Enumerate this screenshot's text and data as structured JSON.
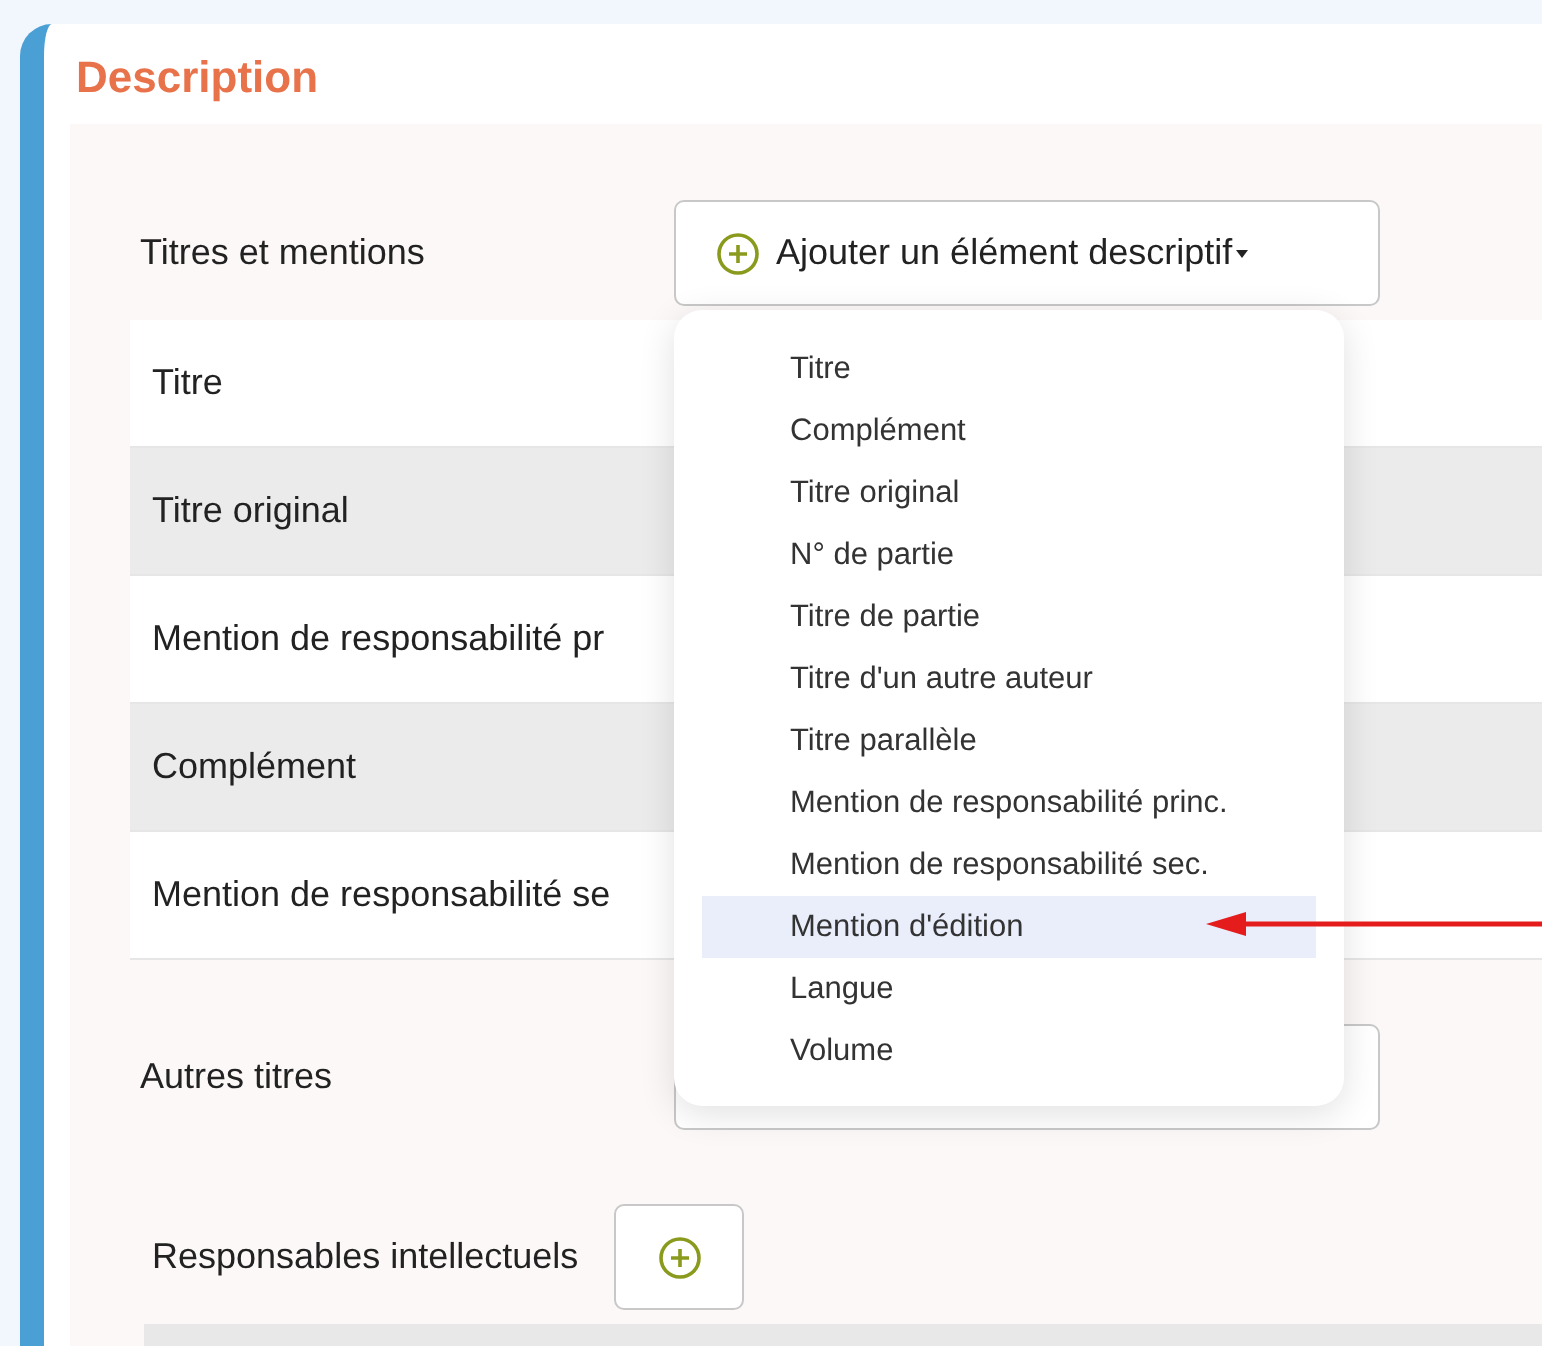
{
  "section": {
    "title": "Description"
  },
  "titles_field": {
    "label": "Titres et mentions",
    "button": {
      "label": "Ajouter un élément descriptif"
    }
  },
  "title_rows": [
    {
      "label": "Titre"
    },
    {
      "label": "Titre original"
    },
    {
      "label": "Mention de responsabilité pr"
    },
    {
      "label": "Complément"
    },
    {
      "label": "Mention de responsabilité se"
    }
  ],
  "dropdown": {
    "items": [
      {
        "label": "Titre",
        "selected": false
      },
      {
        "label": "Complément",
        "selected": false
      },
      {
        "label": "Titre original",
        "selected": false
      },
      {
        "label": "N° de partie",
        "selected": false
      },
      {
        "label": "Titre de partie",
        "selected": false
      },
      {
        "label": "Titre d'un autre auteur",
        "selected": false
      },
      {
        "label": "Titre parallèle",
        "selected": false
      },
      {
        "label": "Mention de responsabilité princ.",
        "selected": false
      },
      {
        "label": "Mention de responsabilité sec.",
        "selected": false
      },
      {
        "label": "Mention d'édition",
        "selected": true
      },
      {
        "label": "Langue",
        "selected": false
      },
      {
        "label": "Volume",
        "selected": false
      }
    ]
  },
  "other_titles": {
    "label": "Autres titres"
  },
  "contributors": {
    "label": "Responsables intellectuels"
  }
}
